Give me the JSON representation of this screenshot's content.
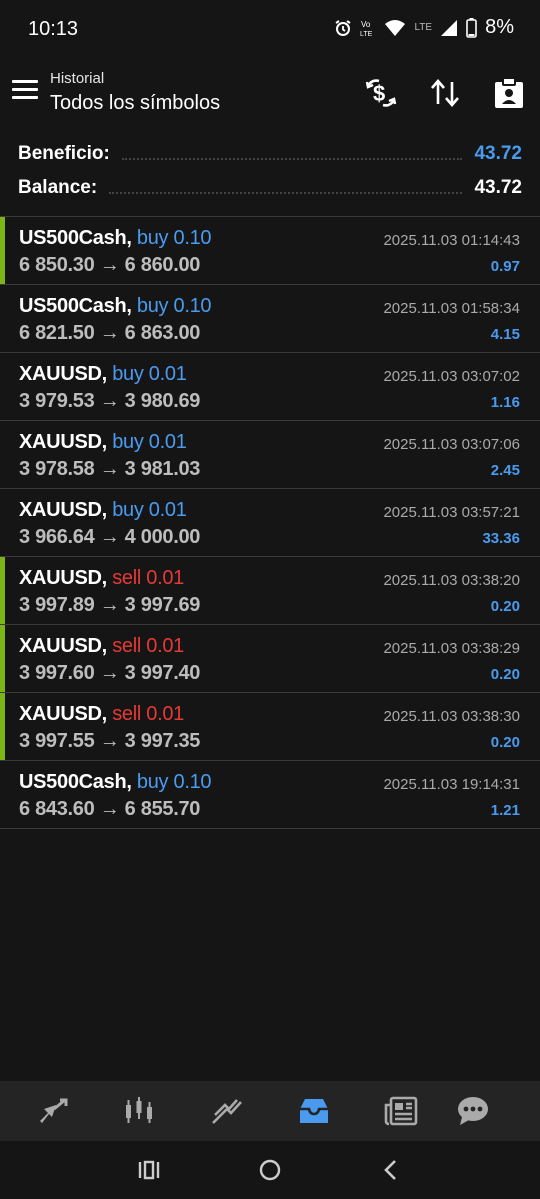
{
  "status_bar": {
    "time": "10:13",
    "network": "LTE",
    "battery": "8%"
  },
  "header": {
    "subtitle": "Historial",
    "title": "Todos los símbolos"
  },
  "summary": {
    "profit_label": "Beneficio:",
    "profit_value": "43.72",
    "balance_label": "Balance:",
    "balance_value": "43.72"
  },
  "colors": {
    "buy": "#4a9bef",
    "sell": "#e53935",
    "accent": "#7cb518",
    "profit": "#4a9bef"
  },
  "deals": [
    {
      "symbol": "US500Cash,",
      "type": "buy",
      "volume": "0.10",
      "type_label": "buy 0.10",
      "prices": "6 850.30 → 6 860.00",
      "time": "2025.11.03 01:14:43",
      "profit": "0.97",
      "accent": true
    },
    {
      "symbol": "US500Cash,",
      "type": "buy",
      "volume": "0.10",
      "type_label": "buy 0.10",
      "prices": "6 821.50 → 6 863.00",
      "time": "2025.11.03 01:58:34",
      "profit": "4.15",
      "accent": false
    },
    {
      "symbol": "XAUUSD,",
      "type": "buy",
      "volume": "0.01",
      "type_label": "buy 0.01",
      "prices": "3 979.53 → 3 980.69",
      "time": "2025.11.03 03:07:02",
      "profit": "1.16",
      "accent": false
    },
    {
      "symbol": "XAUUSD,",
      "type": "buy",
      "volume": "0.01",
      "type_label": "buy 0.01",
      "prices": "3 978.58 → 3 981.03",
      "time": "2025.11.03 03:07:06",
      "profit": "2.45",
      "accent": false
    },
    {
      "symbol": "XAUUSD,",
      "type": "buy",
      "volume": "0.01",
      "type_label": "buy 0.01",
      "prices": "3 966.64 → 4 000.00",
      "time": "2025.11.03 03:57:21",
      "profit": "33.36",
      "accent": false
    },
    {
      "symbol": "XAUUSD,",
      "type": "sell",
      "volume": "0.01",
      "type_label": "sell 0.01",
      "prices": "3 997.89 → 3 997.69",
      "time": "2025.11.03 03:38:20",
      "profit": "0.20",
      "accent": true
    },
    {
      "symbol": "XAUUSD,",
      "type": "sell",
      "volume": "0.01",
      "type_label": "sell 0.01",
      "prices": "3 997.60 → 3 997.40",
      "time": "2025.11.03 03:38:29",
      "profit": "0.20",
      "accent": true
    },
    {
      "symbol": "XAUUSD,",
      "type": "sell",
      "volume": "0.01",
      "type_label": "sell 0.01",
      "prices": "3 997.55 → 3 997.35",
      "time": "2025.11.03 03:38:30",
      "profit": "0.20",
      "accent": true
    },
    {
      "symbol": "US500Cash,",
      "type": "buy",
      "volume": "0.10",
      "type_label": "buy 0.10",
      "prices": "6 843.60 → 6 855.70",
      "time": "2025.11.03 19:14:31",
      "profit": "1.21",
      "accent": false
    }
  ],
  "bottom_nav": [
    {
      "icon": "quotes-icon",
      "active": false
    },
    {
      "icon": "chart-icon",
      "active": false
    },
    {
      "icon": "trade-icon",
      "active": false
    },
    {
      "icon": "history-icon",
      "active": true
    },
    {
      "icon": "news-icon",
      "active": false
    },
    {
      "icon": "chat-icon",
      "active": false
    }
  ]
}
